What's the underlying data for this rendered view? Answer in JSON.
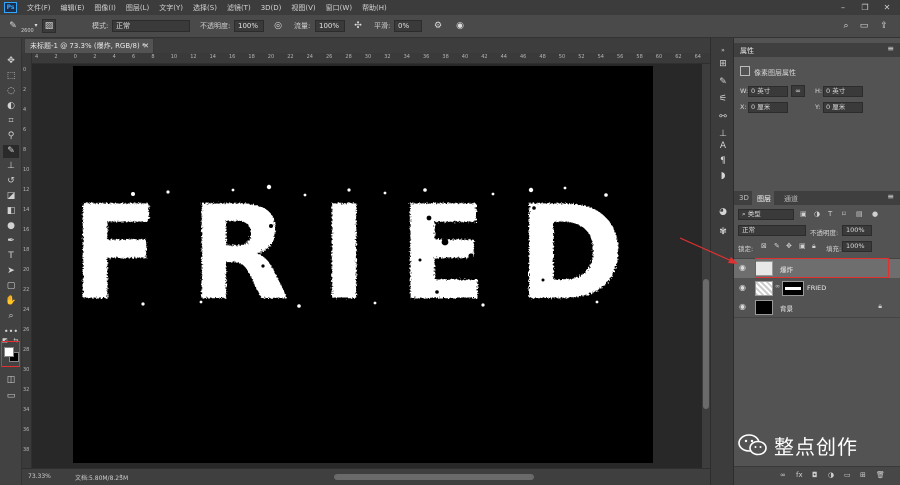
{
  "app": {
    "logo": "Ps",
    "menu": [
      "文件(F)",
      "编辑(E)",
      "图像(I)",
      "图层(L)",
      "文字(Y)",
      "选择(S)",
      "滤镜(T)",
      "3D(D)",
      "视图(V)",
      "窗口(W)",
      "帮助(H)"
    ],
    "window_controls": [
      "minimize-icon",
      "restore-icon",
      "close-icon"
    ]
  },
  "options": {
    "brush_size": "2600",
    "mode_label": "模式:",
    "mode_value": "正常",
    "opacity_label": "不透明度:",
    "opacity_value": "100%",
    "flow_label": "流量:",
    "flow_value": "100%",
    "smoothing_label": "平滑:",
    "smoothing_value": "0%"
  },
  "document": {
    "tab_title": "未标题-1 @ 73.3% (爆炸, RGB/8) *",
    "canvas_text": "FRIED",
    "status_zoom": "73.33%",
    "status_doc": "文档:5.80M/8.25M",
    "ruler_h_ticks": [
      "4",
      "2",
      "0",
      "2",
      "4",
      "6",
      "8",
      "10",
      "12",
      "14",
      "16",
      "18",
      "20",
      "22",
      "24",
      "26",
      "28",
      "30",
      "32",
      "34",
      "36",
      "38",
      "40",
      "42",
      "44",
      "46",
      "48",
      "50",
      "52",
      "54",
      "56",
      "58",
      "60",
      "62",
      "64"
    ],
    "ruler_v_ticks": [
      "0",
      "2",
      "4",
      "6",
      "8",
      "10",
      "12",
      "14",
      "16",
      "18",
      "20",
      "22",
      "24",
      "26",
      "28",
      "30",
      "32",
      "34",
      "36",
      "38"
    ]
  },
  "properties": {
    "title": "属性",
    "subtitle": "像素图层属性",
    "w_label": "W:",
    "w_value": "0 英寸",
    "h_label": "H:",
    "h_value": "0 英寸",
    "x_label": "X:",
    "x_value": "0 厘米",
    "y_label": "Y:",
    "y_value": "0 厘米"
  },
  "layers_panel": {
    "tabs": [
      "3D",
      "图层",
      "通道"
    ],
    "active_tab": "图层",
    "filter_kind": "类型",
    "blend_mode": "正常",
    "opacity_label": "不透明度:",
    "opacity_value": "100%",
    "lock_label": "锁定:",
    "fill_label": "填充:",
    "fill_value": "100%",
    "layers": [
      {
        "name": "爆炸",
        "selected": true,
        "thumb": "#e8e8e8"
      },
      {
        "name": "FRIED",
        "selected": false,
        "thumb": "#ffffff"
      },
      {
        "name": "背景",
        "selected": false,
        "thumb": "#000000"
      }
    ]
  },
  "watermark": {
    "text": "整点创作"
  },
  "colors": {
    "accent_red": "#e03030",
    "canvas": "#000000",
    "panel_bg": "#535353"
  }
}
